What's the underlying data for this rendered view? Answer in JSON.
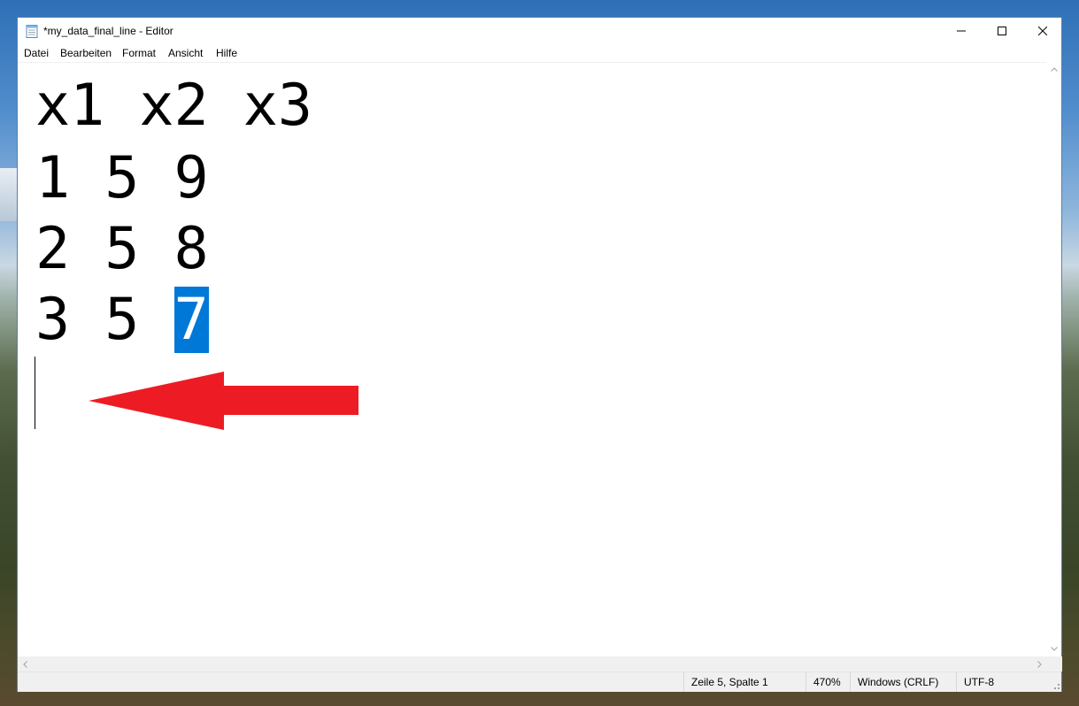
{
  "window": {
    "title": "*my_data_final_line - Editor"
  },
  "menu": {
    "items": [
      "Datei",
      "Bearbeiten",
      "Format",
      "Ansicht",
      "Hilfe"
    ]
  },
  "editor": {
    "lines": [
      {
        "text": "x1 x2 x3",
        "selected": ""
      },
      {
        "text": "1 5 9",
        "selected": ""
      },
      {
        "text": "2 5 8",
        "selected": ""
      },
      {
        "text": "3 5 ",
        "selected": "7"
      }
    ],
    "selection_color": "#0078d7",
    "annotation_arrow_color": "#ed1c24"
  },
  "statusbar": {
    "position": "Zeile 5, Spalte 1",
    "zoom": "470%",
    "line_ending": "Windows (CRLF)",
    "encoding": "UTF-8"
  },
  "icons": {
    "app": "notepad-icon",
    "minimize": "minimize-icon",
    "maximize": "maximize-icon",
    "close": "close-icon"
  }
}
